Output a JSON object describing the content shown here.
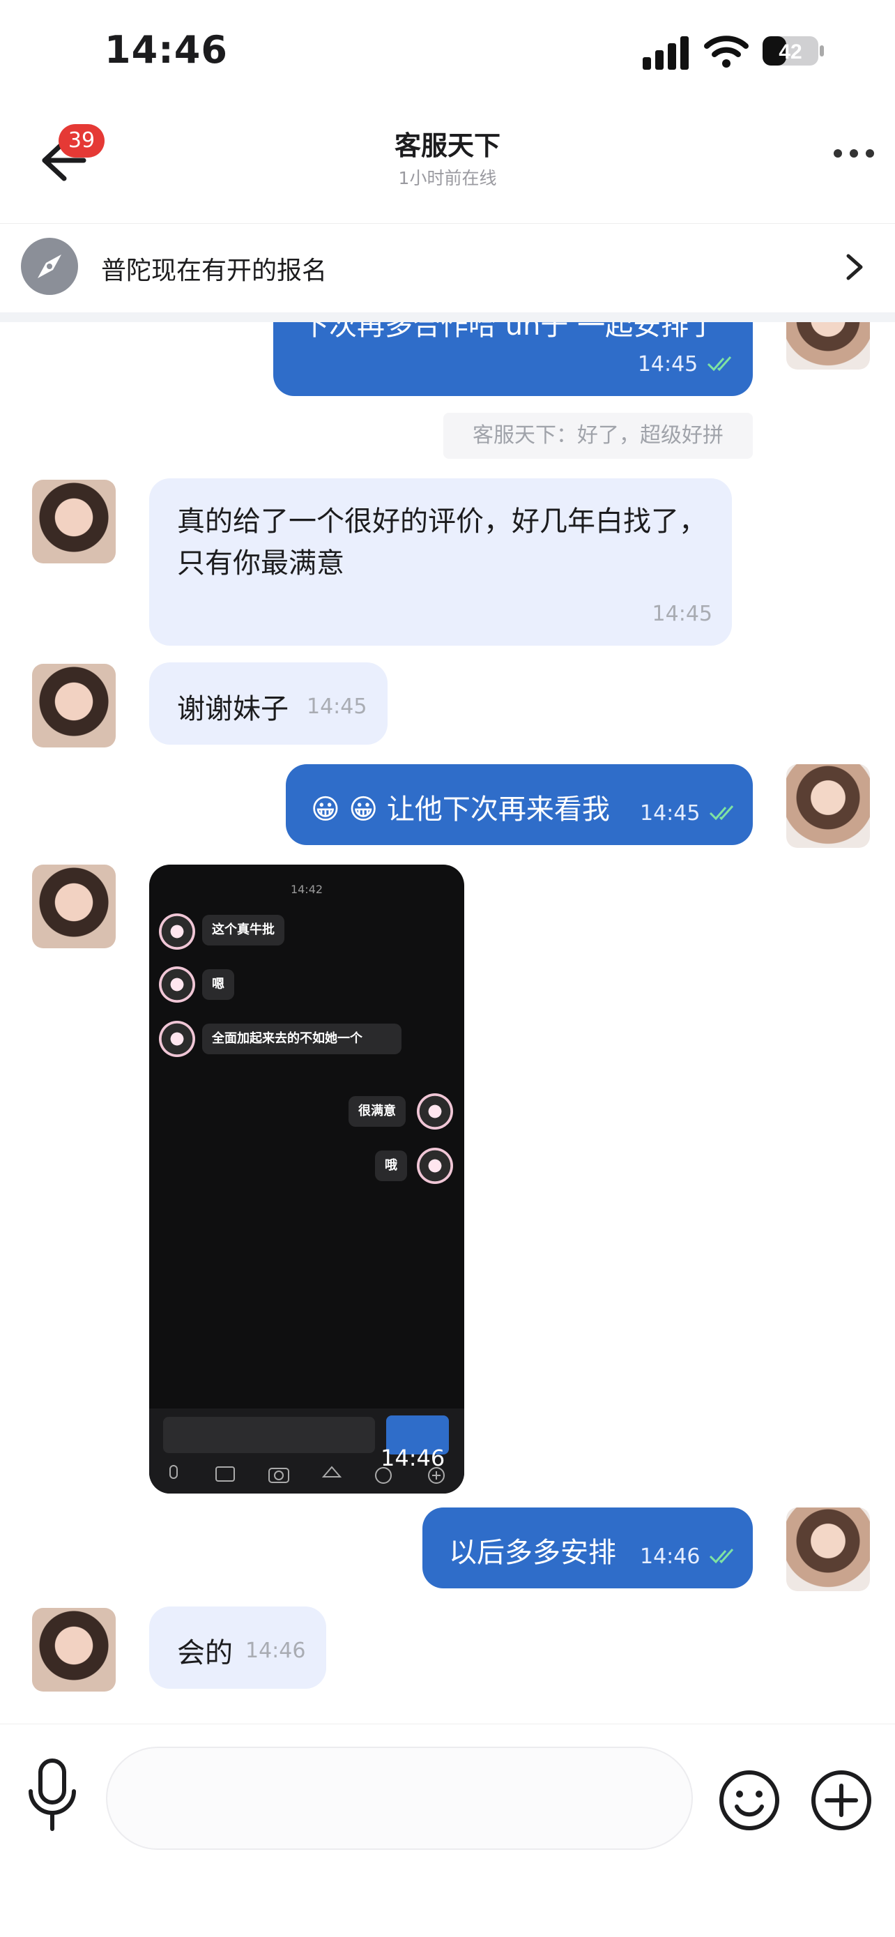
{
  "status_bar": {
    "time": "14:46",
    "battery": "42"
  },
  "nav": {
    "unread_count": "39",
    "title": "客服天下",
    "subtitle": "1小时前在线"
  },
  "pinned": {
    "text": "普陀现在有开的报名"
  },
  "messages": [
    {
      "side": "out",
      "text": "下次再多合作哈 un于 一起安排了",
      "time": "14:45"
    },
    {
      "side": "system",
      "text": "客服天下：好了，超级好拼"
    },
    {
      "side": "in",
      "text": "真的给了一个很好的评价，好几年白找了，只有你最满意",
      "time": "14:45"
    },
    {
      "side": "in",
      "text": "谢谢妹子",
      "time": "14:45"
    },
    {
      "side": "out",
      "text": "😀 😀 让他下次再来看我",
      "time": "14:45"
    },
    {
      "side": "in",
      "type": "image",
      "time": "14:46"
    },
    {
      "side": "out",
      "text": "以后多多安排",
      "time": "14:46"
    },
    {
      "side": "in",
      "text": "会的",
      "time": "14:46"
    }
  ],
  "shot": {
    "top_time": "14:42",
    "msgs": [
      "这个真牛批",
      "嗯",
      "全面加起来去的不如她一个",
      "很满意",
      "哦"
    ]
  },
  "colors": {
    "outgoing_bubble": "#2f6dc9",
    "incoming_bubble": "#eaeffd",
    "badge": "#e53935",
    "read_check": "#7fe3a2"
  }
}
